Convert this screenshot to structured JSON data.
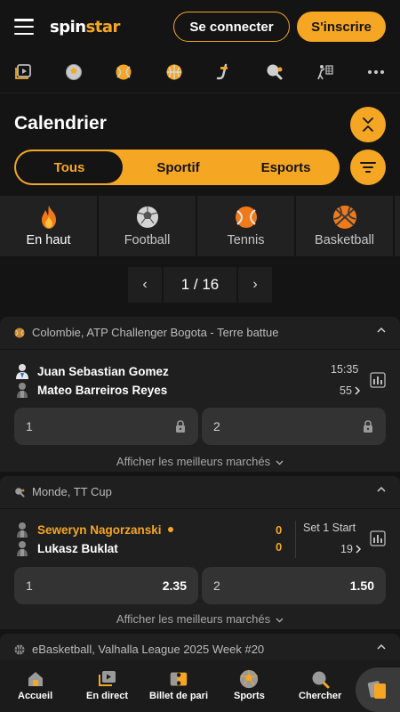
{
  "header": {
    "logo_part1": "spin",
    "logo_part2": "star",
    "login_label": "Se connecter",
    "signup_label": "S'inscrire"
  },
  "sports_bar": {
    "icons": [
      "virtual-sports-icon",
      "football-icon",
      "tennis-icon",
      "basketball-icon",
      "hockey-icon",
      "table-tennis-icon",
      "volleyball-icon",
      "more-icon"
    ]
  },
  "calendar": {
    "title": "Calendrier",
    "tabs": [
      {
        "label": "Tous",
        "active": true
      },
      {
        "label": "Sportif",
        "active": false
      },
      {
        "label": "Esports",
        "active": false
      }
    ]
  },
  "categories": [
    {
      "label": "En haut",
      "icon": "fire-icon",
      "active": true
    },
    {
      "label": "Football",
      "icon": "football-icon",
      "active": false
    },
    {
      "label": "Tennis",
      "icon": "tennis-icon",
      "active": false
    },
    {
      "label": "Basketball",
      "icon": "basketball-icon",
      "active": false
    }
  ],
  "pager": {
    "prev": "‹",
    "current": "1 / 16",
    "next": "›"
  },
  "events": [
    {
      "league": "Colombie, ATP Challenger Bogota - Terre battue",
      "player1": "Juan Sebastian Gomez",
      "player2": "Mateo Barreiros Reyes",
      "time": "15:35",
      "markets_count": "55",
      "odds": [
        {
          "label": "1",
          "value": "",
          "locked": true
        },
        {
          "label": "2",
          "value": "",
          "locked": true
        }
      ],
      "more_label": "Afficher les meilleurs marchés"
    },
    {
      "league": "Monde, TT Cup",
      "player1": "Seweryn Nagorzanski",
      "player2": "Lukasz Buklat",
      "score1": "0",
      "score2": "0",
      "status": "Set 1 Start",
      "markets_count": "19",
      "odds": [
        {
          "label": "1",
          "value": "2.35",
          "locked": false
        },
        {
          "label": "2",
          "value": "1.50",
          "locked": false
        }
      ],
      "more_label": "Afficher les meilleurs marchés"
    },
    {
      "league": "eBasketball, Valhalla League 2025 Week #20"
    }
  ],
  "bottom_nav": [
    {
      "label": "Accueil",
      "icon": "home-icon"
    },
    {
      "label": "En direct",
      "icon": "live-icon"
    },
    {
      "label": "Billet de pari",
      "icon": "ticket-icon"
    },
    {
      "label": "Sports",
      "icon": "sports-ball-icon"
    },
    {
      "label": "Chercher",
      "icon": "search-icon"
    }
  ],
  "colors": {
    "accent": "#f5a623",
    "background": "#141414",
    "card": "#1f1f1f",
    "odd_button": "#333333"
  }
}
